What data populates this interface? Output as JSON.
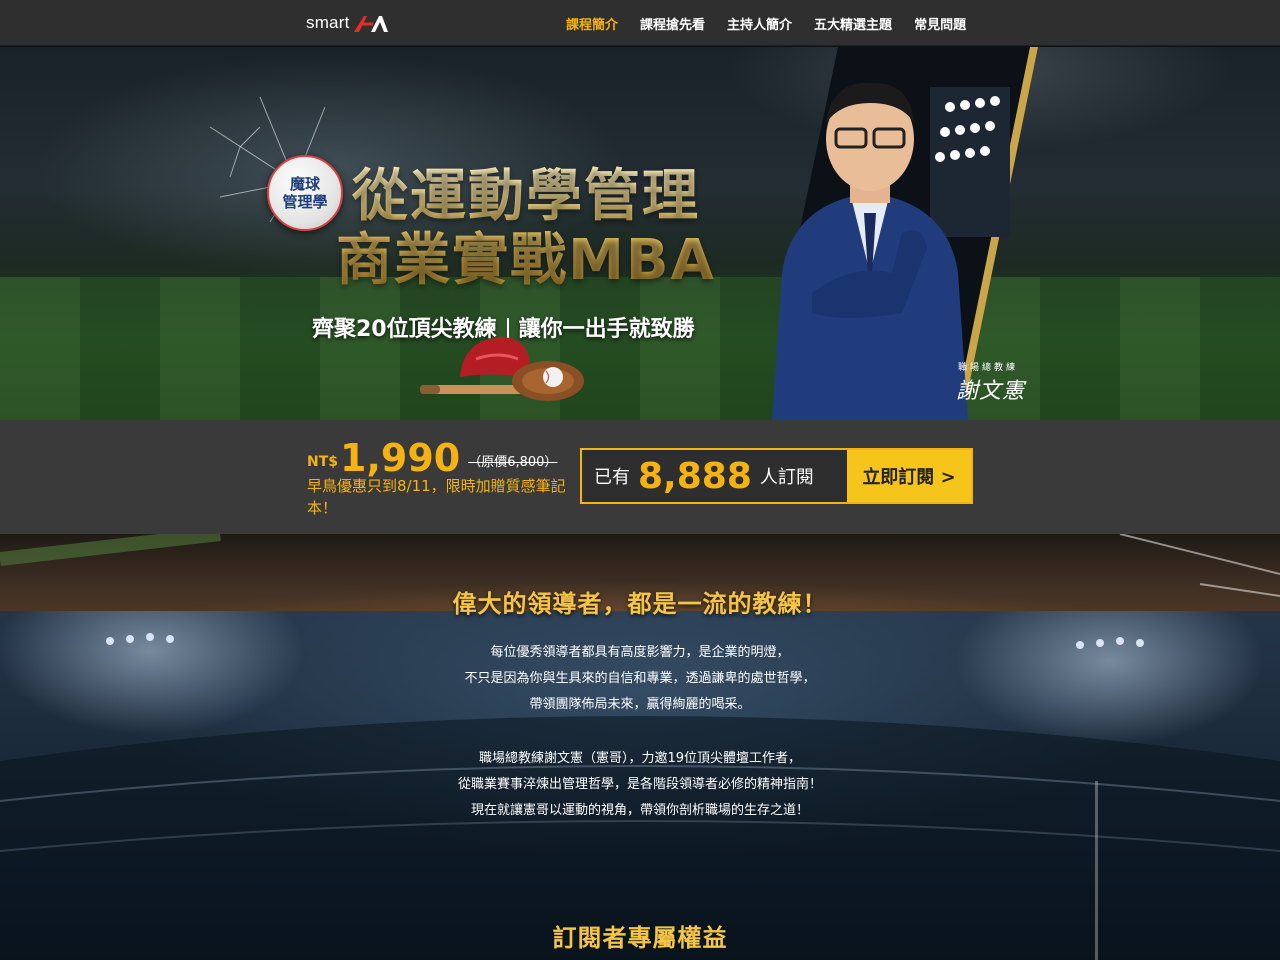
{
  "nav": {
    "logo_text": "smart",
    "items": [
      {
        "label": "課程簡介",
        "active": true
      },
      {
        "label": "課程搶先看",
        "active": false
      },
      {
        "label": "主持人簡介",
        "active": false
      },
      {
        "label": "五大精選主題",
        "active": false
      },
      {
        "label": "常見問題",
        "active": false
      }
    ],
    "active_color": "#f5b313"
  },
  "hero": {
    "badge_line1": "魔球",
    "badge_line2": "管理學",
    "title_line1": "從運動學管理",
    "title_line2": "商業實戰MBA",
    "subtitle_left": "齊聚20位頂尖教練",
    "subtitle_right": "讓你一出手就致勝",
    "host_label": "職場總教練",
    "host_signature": "謝文憲"
  },
  "pricing": {
    "currency": "NT$",
    "price": "1,990",
    "original_price": "（原價6,800）",
    "promo_text": "早鳥優惠只到8/11，限時加贈質感筆記本！",
    "subscribe_prefix": "已有",
    "subscriber_count": "8,888",
    "subscribe_suffix": "人訂閱",
    "cta_label": "立即訂閱 >",
    "accent_color": "#f5b313"
  },
  "intro": {
    "heading": "偉大的領導者，都是一流的教練！",
    "paragraph1": [
      "每位優秀領導者都具有高度影響力，是企業的明燈，",
      "不只是因為你與生具來的自信和專業，透過謙卑的處世哲學，",
      "帶領團隊佈局未來，贏得絢麗的喝采。"
    ],
    "paragraph2": [
      "職場總教練謝文憲（憲哥），力邀19位頂尖體壇工作者，",
      "從職業賽事淬煉出管理哲學，是各階段領導者必修的精神指南！",
      "現在就讓憲哥以運動的視角，帶領你剖析職場的生存之道！"
    ]
  },
  "benefits": {
    "heading": "訂閱者專屬權益"
  }
}
